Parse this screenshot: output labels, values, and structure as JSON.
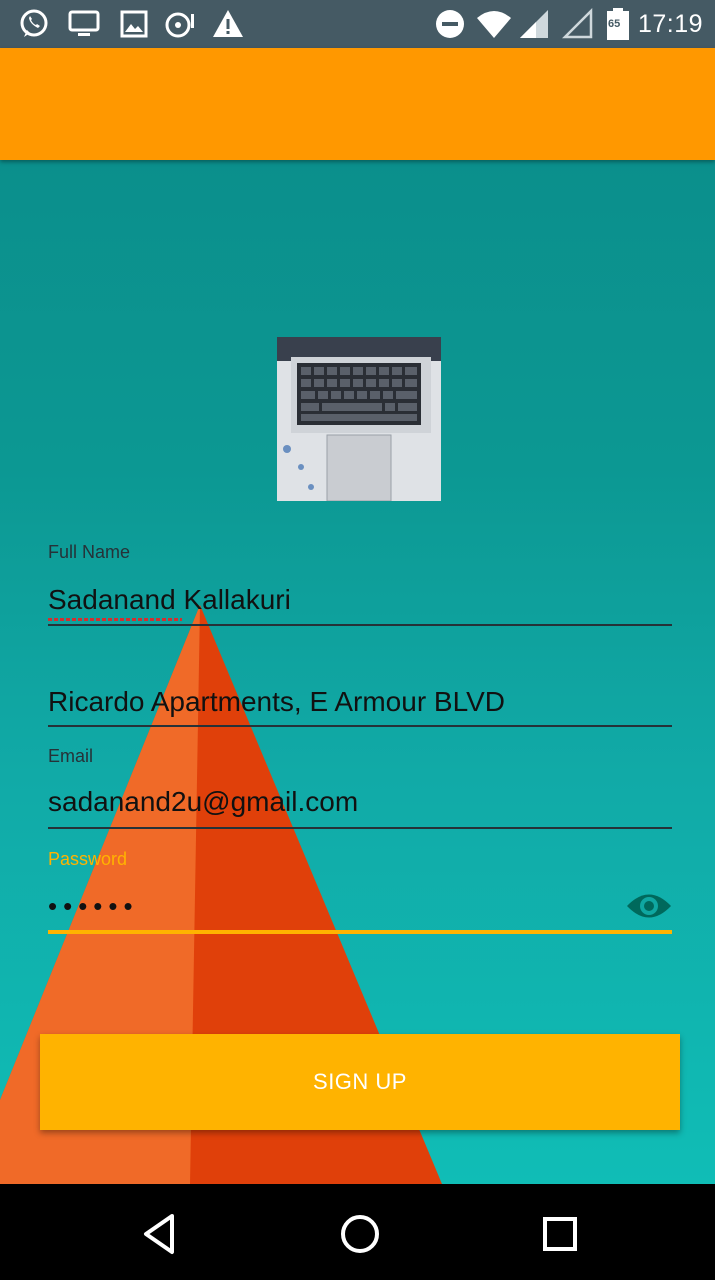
{
  "status_bar": {
    "time": "17:19",
    "battery_level": "65",
    "left_icons": [
      "whatsapp-icon",
      "monitor-icon",
      "image-icon",
      "sync-icon",
      "warning-icon"
    ],
    "right_icons": [
      "do-not-disturb-icon",
      "wifi-icon",
      "signal-icon",
      "signal-empty-icon",
      "battery-icon"
    ]
  },
  "app_bar": {
    "color": "#ff9800"
  },
  "form": {
    "full_name": {
      "label": "Full Name",
      "value": "Sadanand Kallakuri"
    },
    "address": {
      "value": "Ricardo Apartments, E Armour BLVD"
    },
    "email": {
      "label": "Email",
      "value": "sadanand2u@gmail.com"
    },
    "password": {
      "label": "Password",
      "masked_value": "••••••",
      "accent_color": "#ffb300"
    },
    "submit_label": "SIGN UP"
  },
  "nav_bar": {
    "buttons": [
      "back-icon",
      "home-icon",
      "recents-icon"
    ]
  }
}
